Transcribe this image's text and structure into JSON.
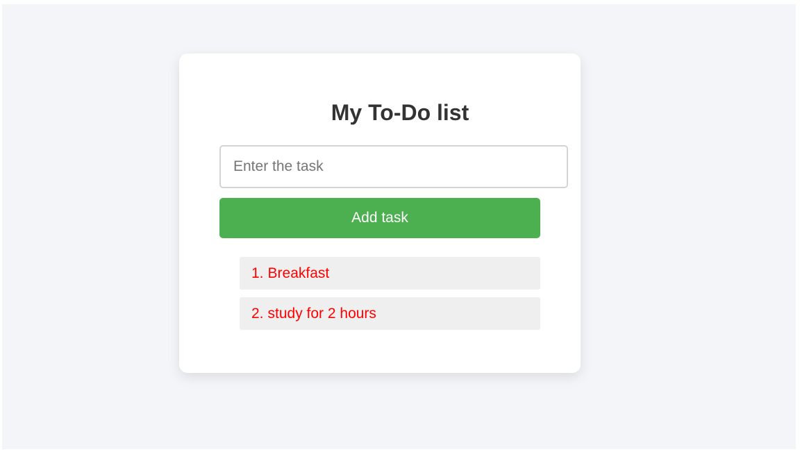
{
  "app": {
    "title": "My To-Do list"
  },
  "form": {
    "input_placeholder": "Enter the task",
    "input_value": "",
    "add_button_label": "Add task"
  },
  "tasks": [
    {
      "number": "1.",
      "text": "Breakfast"
    },
    {
      "number": "2.",
      "text": "study for 2 hours"
    }
  ],
  "colors": {
    "background": "#f4f5f8",
    "card": "#ffffff",
    "button": "#4caf50",
    "task_text": "#ff0000",
    "task_background": "#efefef"
  }
}
